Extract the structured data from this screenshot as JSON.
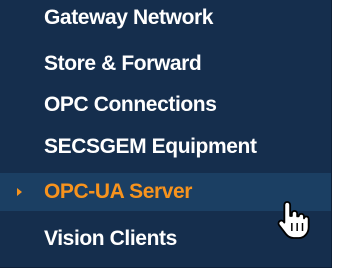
{
  "nav": {
    "items": [
      {
        "label": "Gateway Network"
      },
      {
        "label": "Store & Forward"
      },
      {
        "label": "OPC Connections"
      },
      {
        "label": "SECSGEM Equipment"
      },
      {
        "label": "OPC-UA Server",
        "active": true
      },
      {
        "label": "Vision Clients"
      }
    ]
  },
  "colors": {
    "panel_background": "#152e4d",
    "active_row_background": "#1b3f63",
    "active_text": "#f7931d",
    "text": "#ffffff"
  },
  "icons": {
    "active_indicator": "caret-right-icon",
    "cursor": "hand-pointer-cursor-icon"
  }
}
